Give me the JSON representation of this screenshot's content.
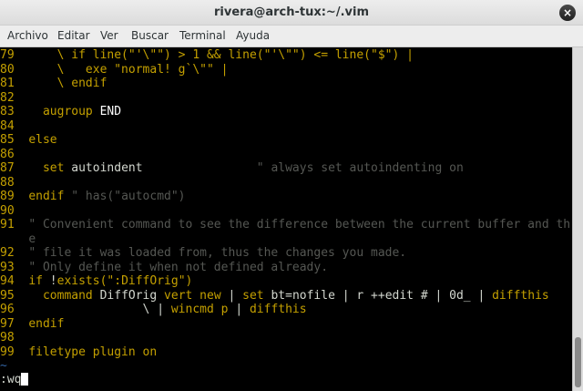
{
  "window": {
    "title": "rivera@arch-tux:~/.vim",
    "close_label": "×"
  },
  "menu": [
    "Archivo",
    "Editar",
    "Ver",
    "Buscar",
    "Terminal",
    "Ayuda"
  ],
  "colors": {
    "number": "#c4a000",
    "keyword": "#c4a000",
    "comment": "#555753",
    "normal": "#d3d7cf",
    "tilde": "#3465a4"
  },
  "editor": {
    "lines": [
      {
        "num": "79",
        "segs": [
          [
            "kw",
            "    \\ if line(\"'\\\"\") > 1 && line(\"'\\\"\") <= line(\"$\") |"
          ]
        ]
      },
      {
        "num": "80",
        "segs": [
          [
            "kw",
            "    \\   exe "
          ],
          [
            "str",
            "\"normal! g`\\\"\""
          ],
          [
            "kw",
            " |"
          ]
        ]
      },
      {
        "num": "81",
        "segs": [
          [
            "kw",
            "    \\ endif"
          ]
        ]
      },
      {
        "num": "82",
        "segs": []
      },
      {
        "num": "83",
        "segs": [
          [
            "kw",
            "  augroup "
          ],
          [
            "wht",
            "END"
          ]
        ]
      },
      {
        "num": "84",
        "segs": []
      },
      {
        "num": "85",
        "segs": [
          [
            "kw",
            "else"
          ]
        ]
      },
      {
        "num": "86",
        "segs": []
      },
      {
        "num": "87",
        "segs": [
          [
            "kw",
            "  set "
          ],
          [
            "nrm",
            "autoindent"
          ],
          [
            "nrm",
            "                "
          ],
          [
            "cmt",
            "\" always set autoindenting on"
          ]
        ]
      },
      {
        "num": "88",
        "segs": []
      },
      {
        "num": "89",
        "segs": [
          [
            "kw",
            "endif "
          ],
          [
            "cmt",
            "\" has(\"autocmd\")"
          ]
        ]
      },
      {
        "num": "90",
        "segs": []
      },
      {
        "num": "91",
        "segs": [
          [
            "cmt",
            "\" Convenient command to see the difference between the current buffer and th"
          ]
        ]
      },
      {
        "num": "",
        "segs": [
          [
            "cmt",
            "e"
          ]
        ]
      },
      {
        "num": "92",
        "segs": [
          [
            "cmt",
            "\" file it was loaded from, thus the changes you made."
          ]
        ]
      },
      {
        "num": "93",
        "segs": [
          [
            "cmt",
            "\" Only define it when not defined already."
          ]
        ]
      },
      {
        "num": "94",
        "segs": [
          [
            "kw",
            "if "
          ],
          [
            "nrm",
            "!"
          ],
          [
            "kw",
            "exists("
          ],
          [
            "str",
            "\":DiffOrig\""
          ],
          [
            "kw",
            ")"
          ]
        ]
      },
      {
        "num": "95",
        "segs": [
          [
            "kw",
            "  command "
          ],
          [
            "nrm",
            "DiffOrig "
          ],
          [
            "kw",
            "vert new "
          ],
          [
            "nrm",
            "| "
          ],
          [
            "kw",
            "set "
          ],
          [
            "nrm",
            "bt=nofile | r ++edit # | 0d_ | "
          ],
          [
            "kw",
            "diffthis"
          ]
        ]
      },
      {
        "num": "96",
        "segs": [
          [
            "nrm",
            "                \\ | "
          ],
          [
            "kw",
            "wincmd p "
          ],
          [
            "nrm",
            "| "
          ],
          [
            "kw",
            "diffthis"
          ]
        ]
      },
      {
        "num": "97",
        "segs": [
          [
            "kw",
            "endif"
          ]
        ]
      },
      {
        "num": "98",
        "segs": []
      },
      {
        "num": "99",
        "segs": [
          [
            "kw",
            "filetype plugin on"
          ]
        ]
      }
    ],
    "tilde": "~",
    "command": ":wq"
  }
}
